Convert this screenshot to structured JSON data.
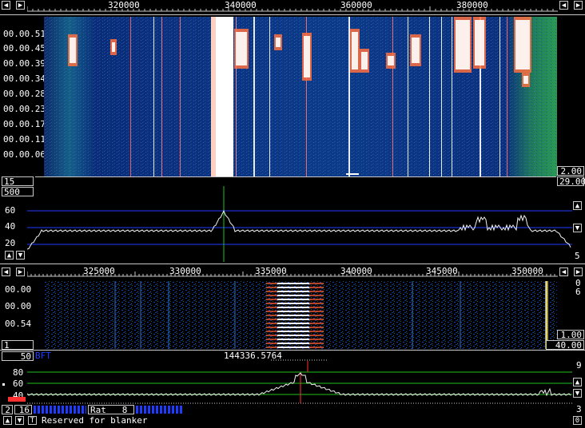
{
  "top_scale": {
    "freq_labels": [
      "320000",
      "340000",
      "360000",
      "380000"
    ],
    "time_labels": [
      "00.00.51",
      "00.00.45",
      "00.00.39",
      "00.00.34",
      "00.00.28",
      "00.00.23",
      "00.00.17",
      "00.00.11",
      "00.00.06"
    ],
    "box_left": "15",
    "box_right_upper": "2.00",
    "box_right_lower": "29.00"
  },
  "spectrum_top": {
    "box_left": "500",
    "y_labels": [
      "60",
      "40",
      "20"
    ],
    "box_right": "5"
  },
  "bottom_scale": {
    "freq_labels": [
      "325000",
      "330000",
      "335000",
      "340000",
      "345000",
      "350000"
    ],
    "time_labels": [
      "00.00",
      "00.00",
      "00.54"
    ],
    "right_labels": [
      "0",
      "6"
    ],
    "box_left": "1",
    "box_right_upper": "1.00",
    "box_right_lower": "40.00"
  },
  "baseband": {
    "box_left": "50",
    "box_left_suffix": "BFT",
    "frequency_readout": "144336.5764",
    "y_labels": [
      "80",
      "60",
      "40"
    ],
    "right_labels": [
      "9",
      "3",
      "0"
    ]
  },
  "status": {
    "box_a": "2",
    "box_b": "16",
    "rat_label": "Rat",
    "rat_value": "8",
    "message": "Reserved for blanker"
  },
  "colors": {
    "accent_blue": "#1e3cff",
    "spectrum_green": "#20c020",
    "marker_red": "#ff3030"
  }
}
